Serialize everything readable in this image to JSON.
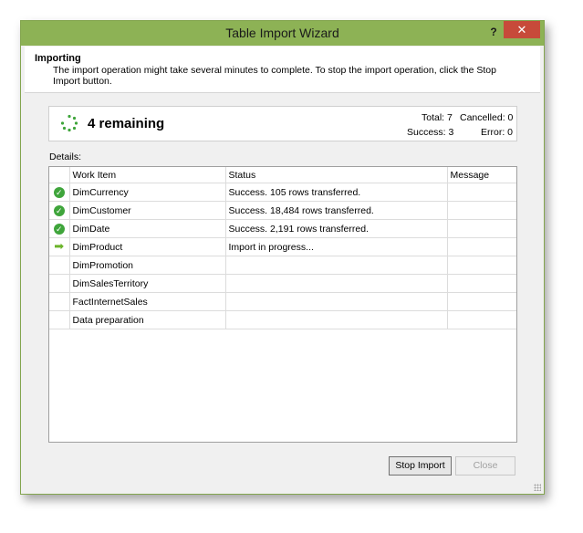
{
  "window": {
    "title": "Table Import Wizard",
    "help_label": "?",
    "close_label": "✕"
  },
  "header": {
    "title": "Importing",
    "description": "The import operation might take several minutes to complete. To stop the import operation, click the Stop Import button."
  },
  "summary": {
    "remaining": "4 remaining",
    "total": "Total: 7",
    "cancelled": "Cancelled: 0",
    "success": "Success: 3",
    "error": "Error: 0"
  },
  "details": {
    "label": "Details:",
    "columns": [
      "",
      "Work Item",
      "Status",
      "Message"
    ],
    "rows": [
      {
        "icon": "check-icon",
        "item": "DimCurrency",
        "status": "Success. 105 rows transferred.",
        "message": ""
      },
      {
        "icon": "check-icon",
        "item": "DimCustomer",
        "status": "Success. 18,484 rows transferred.",
        "message": ""
      },
      {
        "icon": "check-icon",
        "item": "DimDate",
        "status": "Success. 2,191 rows transferred.",
        "message": ""
      },
      {
        "icon": "arrow-right-icon",
        "item": "DimProduct",
        "status": "Import in progress...",
        "message": ""
      },
      {
        "icon": "",
        "item": "DimPromotion",
        "status": "",
        "message": ""
      },
      {
        "icon": "",
        "item": "DimSalesTerritory",
        "status": "",
        "message": ""
      },
      {
        "icon": "",
        "item": "FactInternetSales",
        "status": "",
        "message": ""
      },
      {
        "icon": "",
        "item": "Data preparation",
        "status": "",
        "message": ""
      }
    ]
  },
  "buttons": {
    "stop_import": "Stop Import",
    "close": "Close"
  }
}
